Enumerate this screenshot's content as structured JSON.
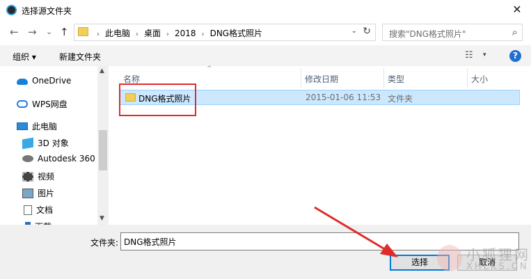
{
  "window": {
    "title": "选择源文件夹",
    "close_glyph": "✕"
  },
  "nav_buttons": {
    "back": "←",
    "forward": "→",
    "recent": "⌄",
    "up": "↑"
  },
  "address": {
    "crumbs": [
      "此电脑",
      "桌面",
      "2018",
      "DNG格式照片"
    ],
    "sep": "›",
    "dropdown": "⌄",
    "refresh": "↻"
  },
  "search": {
    "placeholder": "搜索\"DNG格式照片\"",
    "icon": "⌕"
  },
  "toolbar": {
    "organize": "组织 ▾",
    "new_folder": "新建文件夹",
    "view_icon": "☷",
    "view_dropdown": "▾",
    "help": "?"
  },
  "sidebar": {
    "items": [
      {
        "label": "OneDrive",
        "icon": "cloud-icon"
      },
      {
        "label": "WPS网盘",
        "icon": "wps-cloud-icon"
      },
      {
        "label": "此电脑",
        "icon": "computer-icon"
      },
      {
        "label": "3D 对象",
        "icon": "3d-objects-icon"
      },
      {
        "label": "Autodesk 360",
        "icon": "autodesk-icon"
      },
      {
        "label": "视频",
        "icon": "video-icon"
      },
      {
        "label": "图片",
        "icon": "pictures-icon"
      },
      {
        "label": "文档",
        "icon": "documents-icon"
      },
      {
        "label": "下载",
        "icon": "downloads-icon"
      }
    ],
    "scroll_up": "▲",
    "scroll_down": "▼"
  },
  "columns": {
    "name": "名称",
    "modified": "修改日期",
    "type": "类型",
    "size": "大小",
    "sort_caret": "^"
  },
  "files": [
    {
      "name": "DNG格式照片",
      "modified": "2015-01-06 11:53",
      "type": "文件夹",
      "size": ""
    }
  ],
  "bottom": {
    "folder_label": "文件夹:",
    "folder_value": "DNG格式照片",
    "select_button": "选择",
    "cancel_button": "取消"
  },
  "watermark": {
    "line1": "小狐狸网",
    "line2": "XHLKS.CN"
  },
  "colors": {
    "accent": "#0078d7",
    "selection": "#cce8ff",
    "annotation": "#e02b2b"
  }
}
